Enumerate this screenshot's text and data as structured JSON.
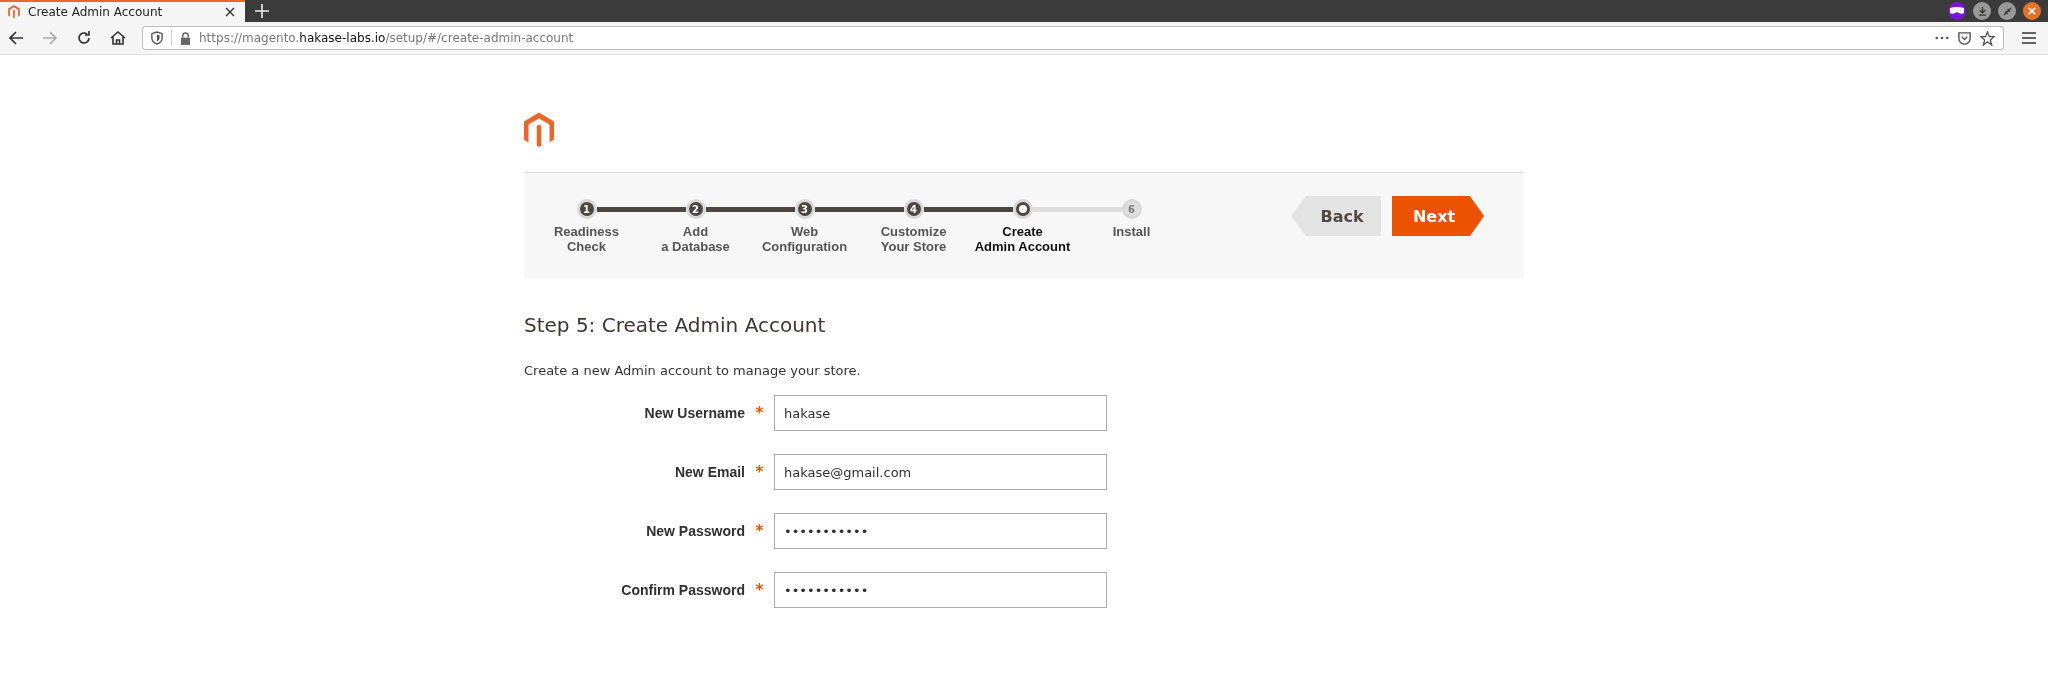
{
  "browser": {
    "tab": {
      "title": "Create Admin Account"
    },
    "url": {
      "prefix": "https://magento.",
      "domain": "hakase-labs.io",
      "path": "/setup/#/create-admin-account"
    }
  },
  "steps": [
    {
      "number": "1",
      "label": [
        "Readiness",
        "Check"
      ],
      "complete": true,
      "selected": false
    },
    {
      "number": "2",
      "label": [
        "Add",
        "a Database"
      ],
      "complete": true,
      "selected": false
    },
    {
      "number": "3",
      "label": [
        "Web",
        "Configuration"
      ],
      "complete": true,
      "selected": false
    },
    {
      "number": "4",
      "label": [
        "Customize",
        "Your Store"
      ],
      "complete": true,
      "selected": false
    },
    {
      "label": [
        "Create",
        "Admin Account"
      ],
      "complete": false,
      "selected": true
    },
    {
      "number": "6",
      "label": [
        "Install"
      ],
      "complete": false,
      "selected": false
    }
  ],
  "buttons": {
    "back": "Back",
    "next": "Next"
  },
  "heading": "Step 5: Create Admin Account",
  "description": "Create a new Admin account to manage your store.",
  "fields": [
    {
      "label": "New Username",
      "required_mark": "*",
      "value": "hakase"
    },
    {
      "label": "New Email",
      "required_mark": "*",
      "value": "hakase@gmail.com"
    },
    {
      "label": "New Password",
      "required_mark": "*",
      "value": "•••••••••••"
    },
    {
      "label": "Confirm Password",
      "required_mark": "*",
      "value": "•••••••••••"
    }
  ]
}
